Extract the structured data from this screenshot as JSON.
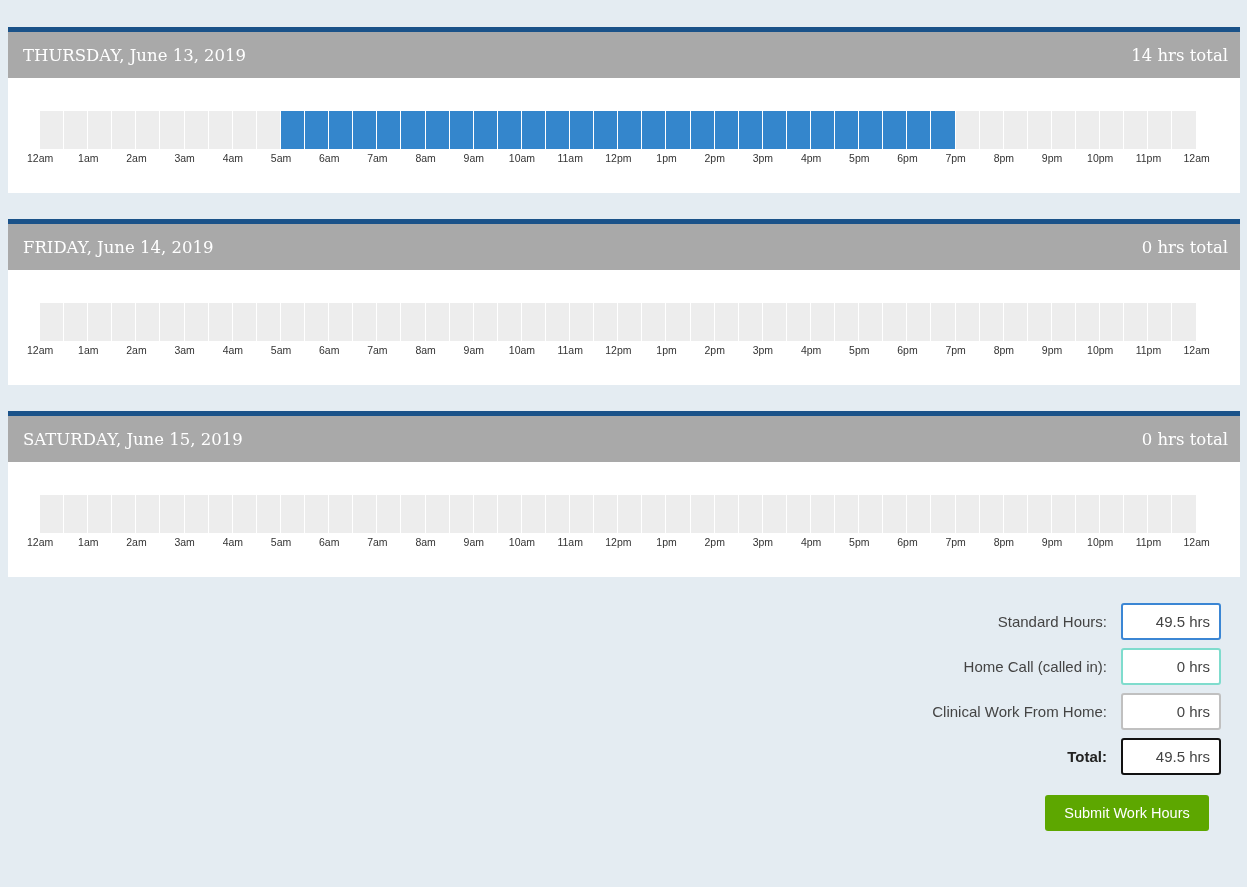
{
  "days": [
    {
      "title": "THURSDAY, June 13, 2019",
      "total": "14 hrs total",
      "slots": [
        {
          "on": false
        },
        {
          "on": false
        },
        {
          "on": false
        },
        {
          "on": false
        },
        {
          "on": false
        },
        {
          "on": false
        },
        {
          "on": false
        },
        {
          "on": false
        },
        {
          "on": false
        },
        {
          "on": false
        },
        {
          "on": true
        },
        {
          "on": true
        },
        {
          "on": true
        },
        {
          "on": true
        },
        {
          "on": true
        },
        {
          "on": true
        },
        {
          "on": true
        },
        {
          "on": true
        },
        {
          "on": true
        },
        {
          "on": true
        },
        {
          "on": true
        },
        {
          "on": true
        },
        {
          "on": true
        },
        {
          "on": true
        },
        {
          "on": true
        },
        {
          "on": true
        },
        {
          "on": true
        },
        {
          "on": true
        },
        {
          "on": true
        },
        {
          "on": true
        },
        {
          "on": true
        },
        {
          "on": true
        },
        {
          "on": true
        },
        {
          "on": true
        },
        {
          "on": true
        },
        {
          "on": true
        },
        {
          "on": true
        },
        {
          "on": true
        },
        {
          "on": false
        },
        {
          "on": false
        },
        {
          "on": false
        },
        {
          "on": false
        },
        {
          "on": false
        },
        {
          "on": false
        },
        {
          "on": false
        },
        {
          "on": false
        },
        {
          "on": false
        },
        {
          "on": false
        }
      ],
      "hour_labels": [
        "12am",
        "1am",
        "2am",
        "3am",
        "4am",
        "5am",
        "6am",
        "7am",
        "8am",
        "9am",
        "10am",
        "11am",
        "12pm",
        "1pm",
        "2pm",
        "3pm",
        "4pm",
        "5pm",
        "6pm",
        "7pm",
        "8pm",
        "9pm",
        "10pm",
        "11pm",
        "12am"
      ]
    },
    {
      "title": "FRIDAY, June 14, 2019",
      "total": "0 hrs total",
      "slots": [
        {
          "on": false
        },
        {
          "on": false
        },
        {
          "on": false
        },
        {
          "on": false
        },
        {
          "on": false
        },
        {
          "on": false
        },
        {
          "on": false
        },
        {
          "on": false
        },
        {
          "on": false
        },
        {
          "on": false
        },
        {
          "on": false
        },
        {
          "on": false
        },
        {
          "on": false
        },
        {
          "on": false
        },
        {
          "on": false
        },
        {
          "on": false
        },
        {
          "on": false
        },
        {
          "on": false
        },
        {
          "on": false
        },
        {
          "on": false
        },
        {
          "on": false
        },
        {
          "on": false
        },
        {
          "on": false
        },
        {
          "on": false
        },
        {
          "on": false
        },
        {
          "on": false
        },
        {
          "on": false
        },
        {
          "on": false
        },
        {
          "on": false
        },
        {
          "on": false
        },
        {
          "on": false
        },
        {
          "on": false
        },
        {
          "on": false
        },
        {
          "on": false
        },
        {
          "on": false
        },
        {
          "on": false
        },
        {
          "on": false
        },
        {
          "on": false
        },
        {
          "on": false
        },
        {
          "on": false
        },
        {
          "on": false
        },
        {
          "on": false
        },
        {
          "on": false
        },
        {
          "on": false
        },
        {
          "on": false
        },
        {
          "on": false
        },
        {
          "on": false
        },
        {
          "on": false
        }
      ],
      "hour_labels": [
        "12am",
        "1am",
        "2am",
        "3am",
        "4am",
        "5am",
        "6am",
        "7am",
        "8am",
        "9am",
        "10am",
        "11am",
        "12pm",
        "1pm",
        "2pm",
        "3pm",
        "4pm",
        "5pm",
        "6pm",
        "7pm",
        "8pm",
        "9pm",
        "10pm",
        "11pm",
        "12am"
      ]
    },
    {
      "title": "SATURDAY, June 15, 2019",
      "total": "0 hrs total",
      "slots": [
        {
          "on": false
        },
        {
          "on": false
        },
        {
          "on": false
        },
        {
          "on": false
        },
        {
          "on": false
        },
        {
          "on": false
        },
        {
          "on": false
        },
        {
          "on": false
        },
        {
          "on": false
        },
        {
          "on": false
        },
        {
          "on": false
        },
        {
          "on": false
        },
        {
          "on": false
        },
        {
          "on": false
        },
        {
          "on": false
        },
        {
          "on": false
        },
        {
          "on": false
        },
        {
          "on": false
        },
        {
          "on": false
        },
        {
          "on": false
        },
        {
          "on": false
        },
        {
          "on": false
        },
        {
          "on": false
        },
        {
          "on": false
        },
        {
          "on": false
        },
        {
          "on": false
        },
        {
          "on": false
        },
        {
          "on": false
        },
        {
          "on": false
        },
        {
          "on": false
        },
        {
          "on": false
        },
        {
          "on": false
        },
        {
          "on": false
        },
        {
          "on": false
        },
        {
          "on": false
        },
        {
          "on": false
        },
        {
          "on": false
        },
        {
          "on": false
        },
        {
          "on": false
        },
        {
          "on": false
        },
        {
          "on": false
        },
        {
          "on": false
        },
        {
          "on": false
        },
        {
          "on": false
        },
        {
          "on": false
        },
        {
          "on": false
        },
        {
          "on": false
        },
        {
          "on": false
        }
      ],
      "hour_labels": [
        "12am",
        "1am",
        "2am",
        "3am",
        "4am",
        "5am",
        "6am",
        "7am",
        "8am",
        "9am",
        "10am",
        "11am",
        "12pm",
        "1pm",
        "2pm",
        "3pm",
        "4pm",
        "5pm",
        "6pm",
        "7pm",
        "8pm",
        "9pm",
        "10pm",
        "11pm",
        "12am"
      ]
    }
  ],
  "summary": [
    {
      "kind": "entry",
      "label": "Standard Hours:",
      "value": "49.5 hrs",
      "color": "#3b86d4"
    },
    {
      "kind": "entry",
      "label": "Home Call (called in):",
      "value": "0 hrs",
      "color": "#7fdccd"
    },
    {
      "kind": "entry",
      "label": "Clinical Work From Home:",
      "value": "0 hrs",
      "color": "#c0c0c0"
    },
    {
      "kind": "total",
      "label": "Total:",
      "value": "49.5 hrs",
      "color": "#111111"
    }
  ],
  "submit_button": "Submit Work Hours"
}
